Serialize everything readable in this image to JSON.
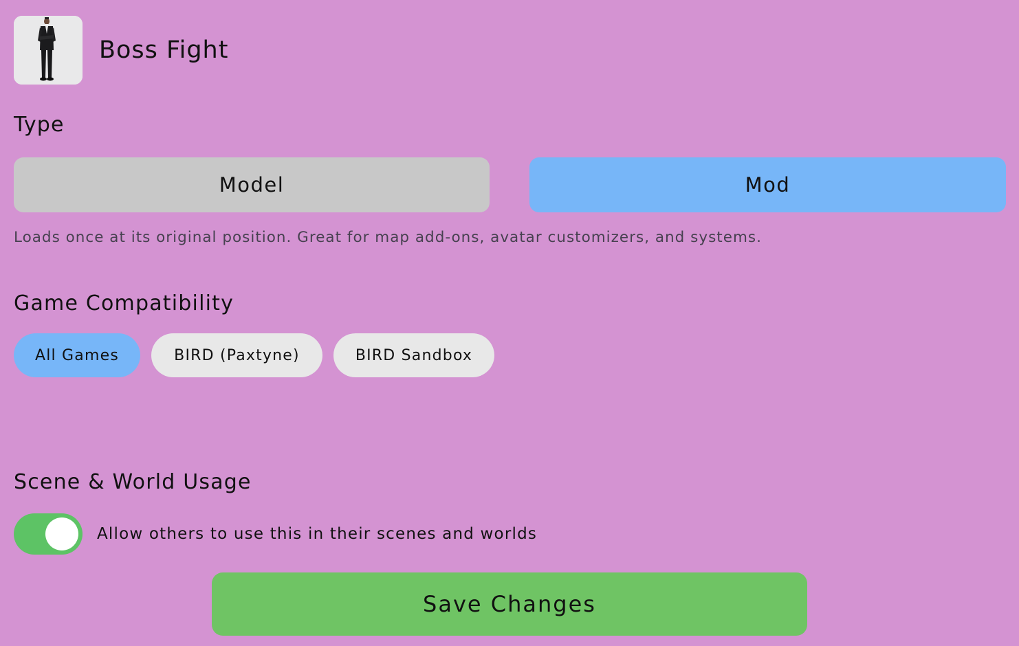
{
  "header": {
    "title": "Boss Fight",
    "thumbnail_icon": "person-in-suit-thumbnail"
  },
  "type_section": {
    "label": "Type",
    "options": [
      {
        "label": "Model",
        "selected": false
      },
      {
        "label": "Mod",
        "selected": true
      }
    ],
    "description": "Loads once at its original position. Great for map add-ons, avatar customizers, and systems."
  },
  "compatibility": {
    "label": "Game Compatibility",
    "options": [
      {
        "label": "All Games",
        "selected": true
      },
      {
        "label": "BIRD (Paxtyne)",
        "selected": false
      },
      {
        "label": "BIRD Sandbox",
        "selected": false
      }
    ]
  },
  "scene_usage": {
    "label": "Scene & World Usage",
    "toggle_on": true,
    "toggle_label": "Allow others to use this in their scenes and worlds"
  },
  "save_label": "Save Changes",
  "colors": {
    "background": "#d493d2",
    "selected": "#77b6f8",
    "unselected_button": "#c8c8c8",
    "chip_unselected": "#e8e8e8",
    "toggle_on": "#5dc365",
    "save_button": "#6fc464"
  }
}
